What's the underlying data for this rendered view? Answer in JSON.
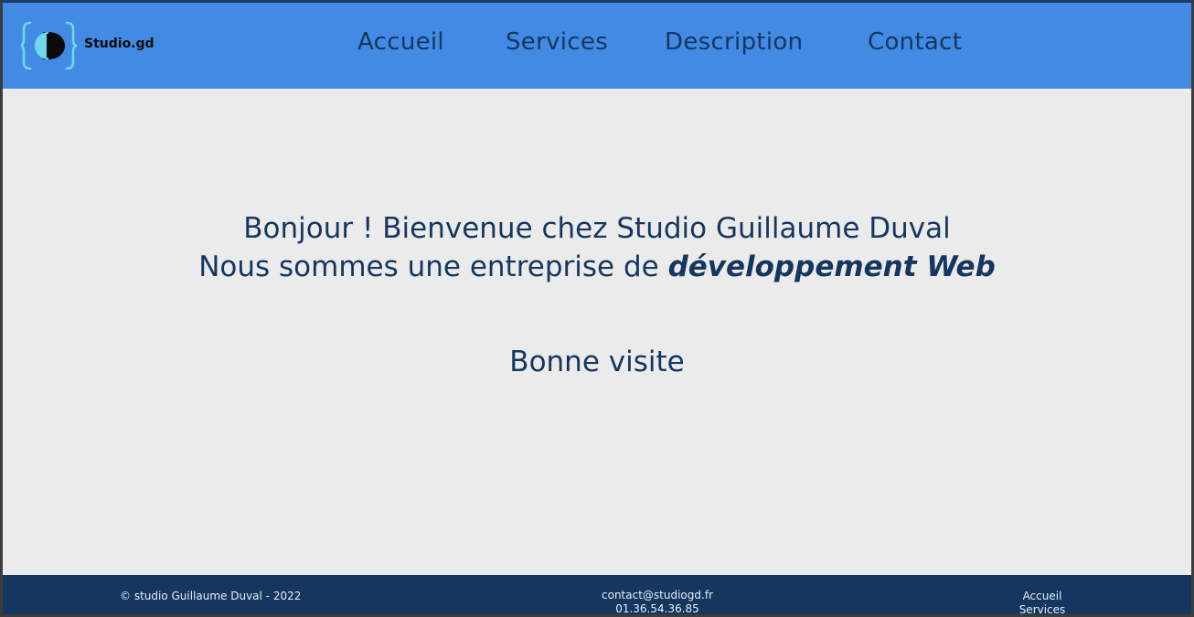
{
  "header": {
    "brand": "Studio.gd",
    "nav": [
      "Accueil",
      "Services",
      "Description",
      "Contact"
    ]
  },
  "hero": {
    "line1": "Bonjour ! Bienvenue chez Studio Guillaume Duval",
    "line2_prefix": "Nous sommes une entreprise de ",
    "line2_emphasis": "développement Web",
    "greeting": "Bonne visite"
  },
  "footer": {
    "copyright": "© studio Guillaume Duval - 2022",
    "email": "contact@studiogd.fr",
    "phone": "01.36.54.36.85",
    "links": [
      "Accueil",
      "Services"
    ]
  },
  "colors": {
    "header_bg": "#428ae4",
    "text_dark": "#15375f",
    "main_bg": "#ebebeb",
    "footer_bg": "#15375f",
    "logo_accent": "#6fd7ee"
  }
}
